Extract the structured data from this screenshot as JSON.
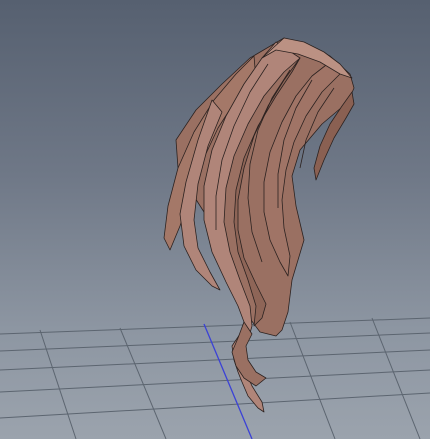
{
  "viewport": {
    "kind": "3d-perspective-view",
    "background_top": "#566070",
    "background_bottom": "#9ba3ad"
  },
  "grid": {
    "visible": true,
    "line_color": "#5c6570",
    "axis_color": "#3b42d6"
  },
  "model": {
    "icon": "hair-strand-mesh",
    "shade_light": "#b08579",
    "shade_mid": "#9a7062",
    "shade_dark": "#7a5548",
    "edge_color": "#2c2220"
  }
}
